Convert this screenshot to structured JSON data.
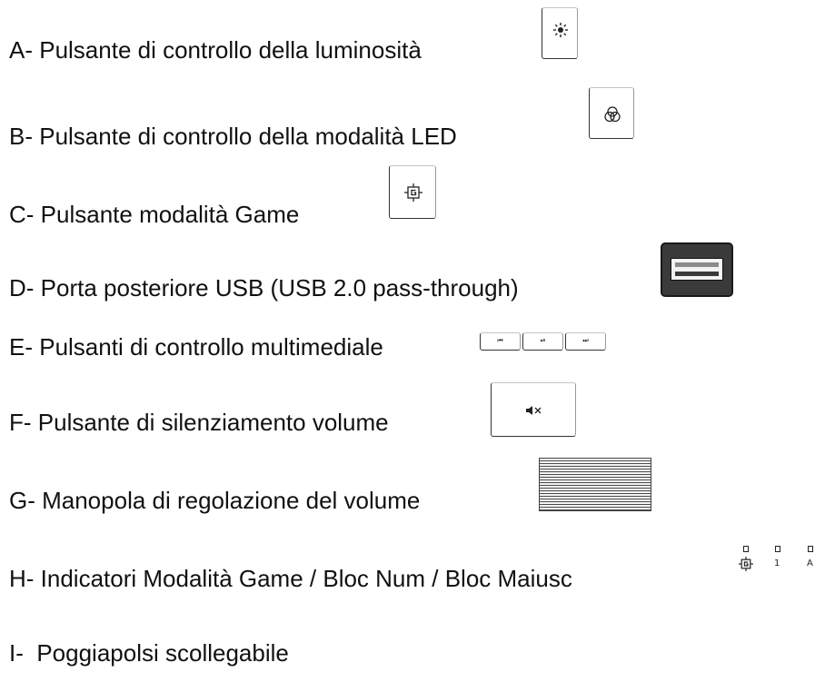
{
  "items": [
    {
      "label": "A- Pulsante di controllo della luminosità",
      "icon": "brightness-icon"
    },
    {
      "label": "B- Pulsante di controllo della modalità LED",
      "icon": "led-mode-icon"
    },
    {
      "label": "C- Pulsante modalità Game",
      "icon": "game-mode-icon"
    },
    {
      "label": "D- Porta posteriore USB (USB 2.0 pass-through)",
      "icon": "usb-port-icon"
    },
    {
      "label": "E- Pulsanti di controllo multimediale",
      "icon": "media-buttons-icon"
    },
    {
      "label": "F- Pulsante di silenziamento volume",
      "icon": "mute-icon"
    },
    {
      "label": "G- Manopola di regolazione del volume",
      "icon": "volume-knob-icon"
    },
    {
      "label": "H- Indicatori Modalità Game / Bloc Num / Bloc Maiusc",
      "icon": "indicators-icon"
    },
    {
      "label": "I-  Poggiapolsi scollegabile",
      "icon": ""
    }
  ],
  "indicators": {
    "num": "1",
    "caps": "A"
  }
}
